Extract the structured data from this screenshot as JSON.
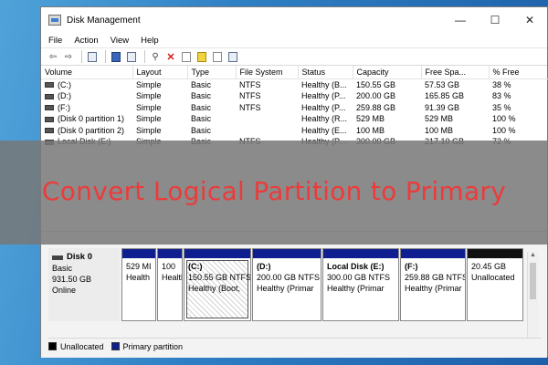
{
  "window": {
    "title": "Disk Management",
    "controls": {
      "minimize": "—",
      "maximize": "☐",
      "close": "✕"
    }
  },
  "menu": [
    "File",
    "Action",
    "View",
    "Help"
  ],
  "toolbar": {
    "icons": [
      "back-arrow-icon",
      "forward-arrow-icon",
      "console-tree-icon",
      "help-icon",
      "properties-icon",
      "connect-disk-icon",
      "delete-icon",
      "check-disk-icon",
      "new-volume-icon",
      "format-icon",
      "details-icon"
    ]
  },
  "table": {
    "columns": [
      "Volume",
      "Layout",
      "Type",
      "File System",
      "Status",
      "Capacity",
      "Free Spa...",
      "% Free"
    ],
    "rows": [
      [
        "(C:)",
        "Simple",
        "Basic",
        "NTFS",
        "Healthy (B...",
        "150.55 GB",
        "57.53 GB",
        "38 %"
      ],
      [
        "(D:)",
        "Simple",
        "Basic",
        "NTFS",
        "Healthy (P...",
        "200.00 GB",
        "165.85 GB",
        "83 %"
      ],
      [
        "(F:)",
        "Simple",
        "Basic",
        "NTFS",
        "Healthy (P...",
        "259.88 GB",
        "91.39 GB",
        "35 %"
      ],
      [
        "(Disk 0 partition 1)",
        "Simple",
        "Basic",
        "",
        "Healthy (R...",
        "529 MB",
        "529 MB",
        "100 %"
      ],
      [
        "(Disk 0 partition 2)",
        "Simple",
        "Basic",
        "",
        "Healthy (E...",
        "100 MB",
        "100 MB",
        "100 %"
      ],
      [
        "Local Disk (E:)",
        "Simple",
        "Basic",
        "NTFS",
        "Healthy (P...",
        "300.00 GB",
        "217.10 GB",
        "72 %"
      ]
    ]
  },
  "banner": {
    "text": "Convert Logical Partition to Primary"
  },
  "disk": {
    "name": "Disk 0",
    "type": "Basic",
    "size": "931.50 GB",
    "status": "Online",
    "partitions": [
      {
        "name": "",
        "line1": "529 MI",
        "line2": "Health",
        "kind": "primary"
      },
      {
        "name": "",
        "line1": "100",
        "line2": "Health",
        "kind": "primary"
      },
      {
        "name": "(C:)",
        "line1": "150.55 GB NTFS",
        "line2": "Healthy (Boot,",
        "kind": "primary-selected"
      },
      {
        "name": "(D:)",
        "line1": "200.00 GB NTFS",
        "line2": "Healthy (Primar",
        "kind": "primary"
      },
      {
        "name": "Local Disk  (E:)",
        "line1": "300.00 GB NTFS",
        "line2": "Healthy (Primar",
        "kind": "primary"
      },
      {
        "name": "(F:)",
        "line1": "259.88 GB NTFS",
        "line2": "Healthy (Primar",
        "kind": "primary"
      },
      {
        "name": "",
        "line1": "20.45 GB",
        "line2": "Unallocated",
        "kind": "unallocated"
      }
    ]
  },
  "legend": [
    {
      "label": "Unallocated",
      "color": "#000000"
    },
    {
      "label": "Primary partition",
      "color": "#0f1f8f"
    }
  ],
  "colors": {
    "desktop": "#2f7fc4",
    "primary_bar": "#0f1f8f",
    "unallocated_bar": "#111111",
    "banner_text": "#ec3b3b"
  }
}
